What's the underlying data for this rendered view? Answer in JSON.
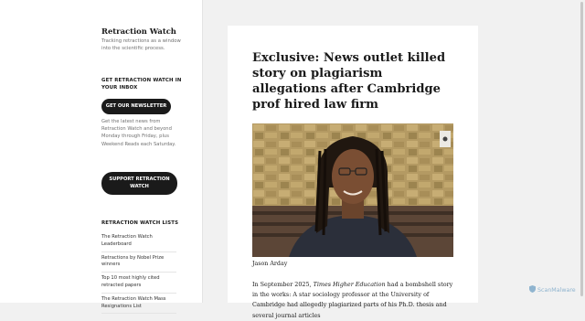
{
  "sidebar": {
    "site_title": "Retraction Watch",
    "site_description": "Tracking retractions as a window into the scientific process.",
    "newsletter_heading": "GET RETRACTION WATCH IN YOUR INBOX",
    "newsletter_button": "GET OUR NEWSLETTER",
    "newsletter_text": "Get the latest news from Retraction Watch and beyond Monday through Friday, plus Weekend Reads each Saturday.",
    "support_button": "SUPPORT RETRACTION WATCH",
    "lists_heading": "RETRACTION WATCH LISTS",
    "lists": [
      "The Retraction Watch Leaderboard",
      "Retractions by Nobel Prize winners",
      "Top 10 most highly cited retracted papers",
      "The Retraction Watch Mass Resignations List"
    ]
  },
  "article": {
    "title": "Exclusive: News outlet killed story on plagiarism allegations after Cambridge prof hired law firm",
    "photo_caption": "Jason Arday",
    "body_prefix": "In September 2025, ",
    "body_publication": "Times Higher Education",
    "body_suffix": " had a bombshell story in the works: A star sociology professor at the University of Cambridge had allegedly plagiarized parts of his Ph.D. thesis and several journal articles"
  },
  "overlay": {
    "watermark": "ScanMalware",
    "watermark_icon": "shield-icon"
  },
  "colors": {
    "button_bg": "#1a1a1a",
    "page_bg": "#f1f1f1",
    "link_text": "#333333"
  }
}
